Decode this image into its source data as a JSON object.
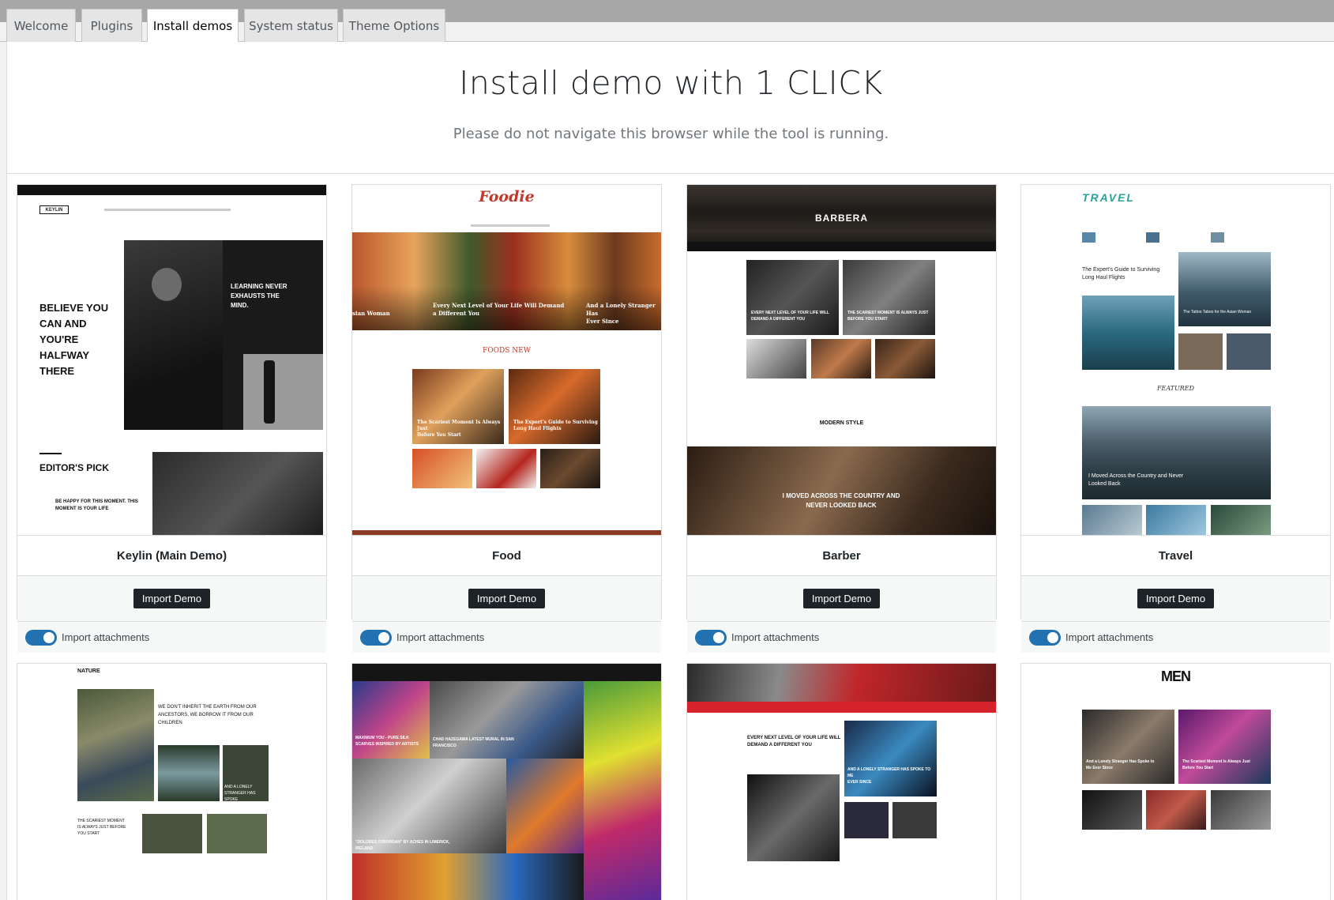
{
  "tabs": [
    {
      "label": "Welcome",
      "active": false
    },
    {
      "label": "Plugins",
      "active": false
    },
    {
      "label": "Install demos",
      "active": true
    },
    {
      "label": "System status",
      "active": false
    },
    {
      "label": "Theme Options",
      "active": false
    }
  ],
  "header": {
    "title": "Install demo with 1 CLICK",
    "subtitle": "Please do not navigate this browser while the tool is running."
  },
  "demos": [
    {
      "name": "Keylin (Main Demo)",
      "button": "Import Demo",
      "attachments_label": "Import attachments",
      "attachments_on": true,
      "preview": {
        "logo": "KEYLIN",
        "headline_lines": [
          "BELIEVE YOU",
          "CAN AND",
          "YOU'RE",
          "HALFWAY",
          "THERE"
        ],
        "feature_lines": [
          "LEARNING NEVER",
          "EXHAUSTS THE",
          "MIND."
        ],
        "section": "EDITOR'S PICK",
        "item_lines": [
          "BE HAPPY FOR THIS MOMENT. THIS",
          "MOMENT IS YOUR LIFE"
        ]
      }
    },
    {
      "name": "Food",
      "button": "Import Demo",
      "attachments_label": "Import attachments",
      "attachments_on": true,
      "preview": {
        "logo": "Foodie",
        "hero_lines": [
          "Every Next Level of Your Life Will Demand",
          "a Different You"
        ],
        "hero_side_left": "sian Woman",
        "hero_side_right_lines": [
          "And a Lonely Stranger Has",
          "Ever Since"
        ],
        "section": "FOODS NEW",
        "card_a_lines": [
          "The Scariest Moment Is Always Just",
          "Before You Start"
        ],
        "card_b_lines": [
          "The Expert's Guide to Surviving",
          "Long Haul Flights"
        ]
      }
    },
    {
      "name": "Barber",
      "button": "Import Demo",
      "attachments_label": "Import attachments",
      "attachments_on": true,
      "preview": {
        "logo": "BARBERA",
        "card_a_lines": [
          "EVERY NEXT LEVEL OF YOUR LIFE WILL",
          "DEMAND A DIFFERENT YOU"
        ],
        "card_b_lines": [
          "THE SCARIEST MOMENT IS ALWAYS JUST",
          "BEFORE YOU START"
        ],
        "section": "MODERN STYLE",
        "hero_lines": [
          "I MOVED ACROSS THE COUNTRY AND",
          "NEVER LOOKED BACK"
        ]
      }
    },
    {
      "name": "Travel",
      "button": "Import Demo",
      "attachments_label": "Import attachments",
      "attachments_on": true,
      "preview": {
        "logo": "TRAVEL",
        "post_lines": [
          "The Expert's Guide to Surviving",
          "Long Haul Flights"
        ],
        "side_caption": "The Tattoo Taboo for the Asian Woman",
        "section": "FEATURED",
        "hero_lines": [
          "I Moved Across the Country and Never",
          "Looked Back"
        ]
      }
    },
    {
      "preview": {
        "logo": "NATURE",
        "post_lines": [
          "WE DON'T INHERIT THE EARTH FROM OUR",
          "ANCESTORS, WE BORROW IT FROM OUR",
          "CHILDREN"
        ],
        "side_lines": [
          "AND A LONELY",
          "STRANGER HAS SPOKE",
          "TO ME EVER SINCE"
        ],
        "bottom_lines": [
          "THE SCARIEST MOMENT",
          "IS ALWAYS JUST BEFORE",
          "YOU START"
        ]
      }
    },
    {
      "preview": {
        "caption_a_lines": [
          "MAXIMUM YOU - PURE SILK",
          "SCARVES INSPIRED BY ARTISTS"
        ],
        "caption_b_lines": [
          "CHAD HAZEGAWA LATEST MURAL IN SAN",
          "FRANCISCO"
        ],
        "caption_c_lines": [
          "\"DOLORES O'RIORDAN\" BY ACHES IN LIMERICK,",
          "IRELAND"
        ]
      }
    },
    {
      "preview": {
        "post_lines": [
          "EVERY NEXT LEVEL OF YOUR LIFE WILL",
          "DEMAND A DIFFERENT YOU"
        ],
        "side_lines": [
          "AND A LONELY STRANGER HAS SPOKE TO ME",
          "EVER SINCE"
        ]
      }
    },
    {
      "preview": {
        "logo": "MEN",
        "card_a_lines": [
          "And a Lonely Stranger Has Spoke to",
          "Me Ever Since"
        ],
        "card_b_lines": [
          "The Scariest Moment Is Always Just",
          "Before You Start"
        ]
      }
    }
  ],
  "colors": {
    "accent": "#2271b1",
    "button": "#1d2327",
    "foodie_red": "#c0392b",
    "travel_teal": "#2aa39a",
    "camera_red": "#d6222a"
  }
}
